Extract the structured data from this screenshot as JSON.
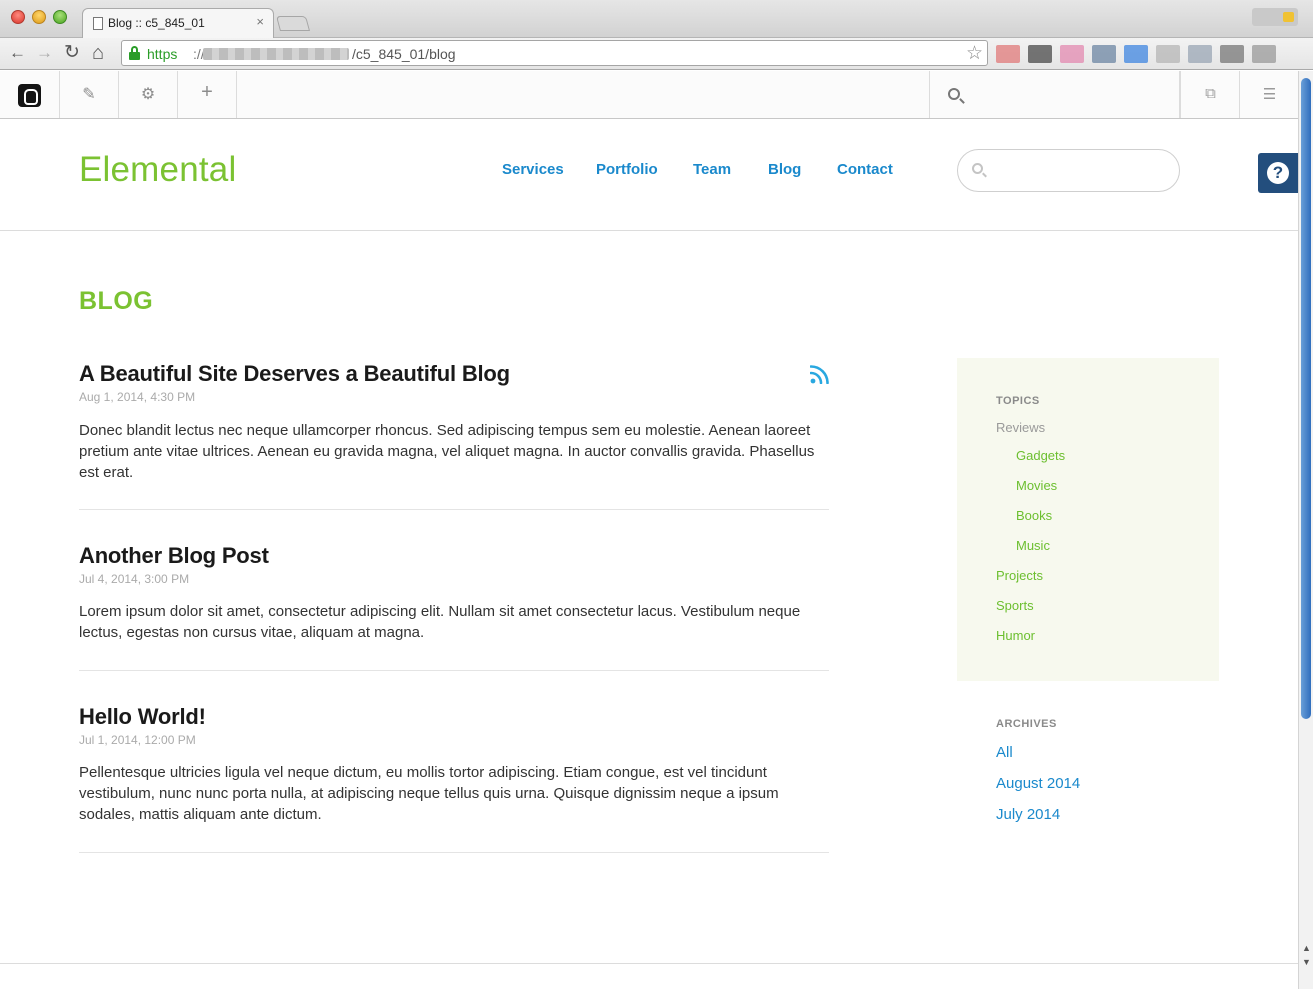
{
  "browser": {
    "tab_title": "Blog :: c5_845_01",
    "tab_close": "×",
    "url_scheme": "https",
    "url_separator": "://",
    "url_path": "/c5_845_01/blog",
    "nav_back": "←",
    "nav_forward": "→",
    "nav_reload": "↻",
    "nav_home": "⌂",
    "bookmark_star": "☆",
    "extensions": [
      "#e07a7a",
      "#4a4a4a",
      "#e38ab0",
      "#6c86a3",
      "#3f86e0",
      "#b5b5b5",
      "#9aa6b4",
      "#777777",
      "#9a9a9a"
    ]
  },
  "cms_toolbar": {
    "edit_glyph": "✎",
    "settings_glyph": "⚙",
    "add_glyph": "+",
    "pages_glyph": "⧉",
    "options_glyph": "☰"
  },
  "site": {
    "logo": "Elemental",
    "nav": [
      "Services",
      "Portfolio",
      "Team",
      "Blog",
      "Contact"
    ],
    "search_placeholder": "",
    "help_glyph": "?"
  },
  "page": {
    "title": "BLOG"
  },
  "posts": [
    {
      "title": "A Beautiful Site Deserves a Beautiful Blog",
      "date": "Aug 1, 2014, 4:30 PM",
      "body": "Donec blandit lectus nec neque ullamcorper rhoncus. Sed adipiscing tempus sem eu molestie. Aenean laoreet pretium ante vitae ultrices. Aenean eu gravida magna, vel aliquet magna. In auctor convallis gravida. Phasellus est erat."
    },
    {
      "title": "Another Blog Post",
      "date": "Jul 4, 2014, 3:00 PM",
      "body": "Lorem ipsum dolor sit amet, consectetur adipiscing elit. Nullam sit amet consectetur lacus. Vestibulum neque lectus, egestas non cursus vitae, aliquam at magna."
    },
    {
      "title": "Hello World!",
      "date": "Jul 1, 2014, 12:00 PM",
      "body": "Pellentesque ultricies ligula vel neque dictum, eu mollis tortor adipiscing. Etiam congue, est vel tincidunt vestibulum, nunc nunc porta nulla, at adipiscing neque tellus quis urna. Quisque dignissim neque a ipsum sodales, mattis aliquam ante dictum."
    }
  ],
  "sidebar": {
    "topics_heading": "TOPICS",
    "topics": [
      {
        "label": "Reviews",
        "parent": true
      },
      {
        "label": "Gadgets",
        "parent": false
      },
      {
        "label": "Movies",
        "parent": false
      },
      {
        "label": "Books",
        "parent": false
      },
      {
        "label": "Music",
        "parent": false
      },
      {
        "label": "Projects",
        "parent": false
      },
      {
        "label": "Sports",
        "parent": false
      },
      {
        "label": "Humor",
        "parent": false
      }
    ],
    "archives_heading": "ARCHIVES",
    "archives": [
      "All",
      "August 2014",
      "July 2014"
    ]
  },
  "colors": {
    "brand_green": "#7bc232",
    "link_blue": "#1a89cc",
    "help_navy": "#234e7d",
    "topics_bg": "#f7f9ee"
  }
}
